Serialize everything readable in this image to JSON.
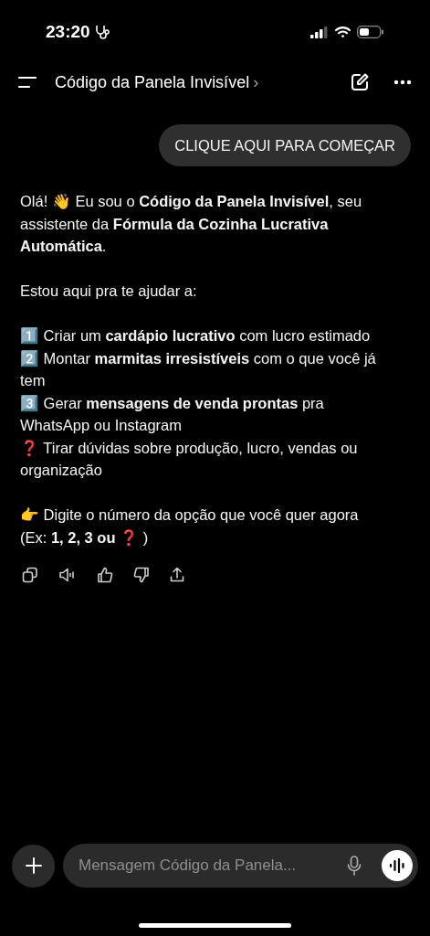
{
  "status_bar": {
    "time": "23:20"
  },
  "header": {
    "title": "Código da Panela Invisível",
    "chevron": "›"
  },
  "user_message": "CLIQUE AQUI PARA COMEÇAR",
  "assistant_message": {
    "paragraphs": [
      {
        "lines": [
          "Olá! 👋 Eu sou o **Código da Panela Invisível**, seu assistente da **Fórmula da Cozinha Lucrativa Automática**."
        ]
      },
      {
        "lines": [
          "Estou aqui pra te ajudar a:"
        ]
      },
      {
        "lines": [
          "1️⃣ Criar um **cardápio lucrativo** com lucro estimado",
          "2️⃣ Montar **marmitas irresistíveis** com o que você já tem",
          "3️⃣ Gerar **mensagens de venda prontas** pra WhatsApp ou Instagram",
          "❓ Tirar dúvidas sobre produção, lucro, vendas ou organização"
        ]
      },
      {
        "lines": [
          "👉 Digite o número da opção que você quer agora (Ex: **1, 2, 3 ou** ❓ )"
        ]
      }
    ]
  },
  "composer": {
    "placeholder": "Mensagem Código da Panela..."
  }
}
